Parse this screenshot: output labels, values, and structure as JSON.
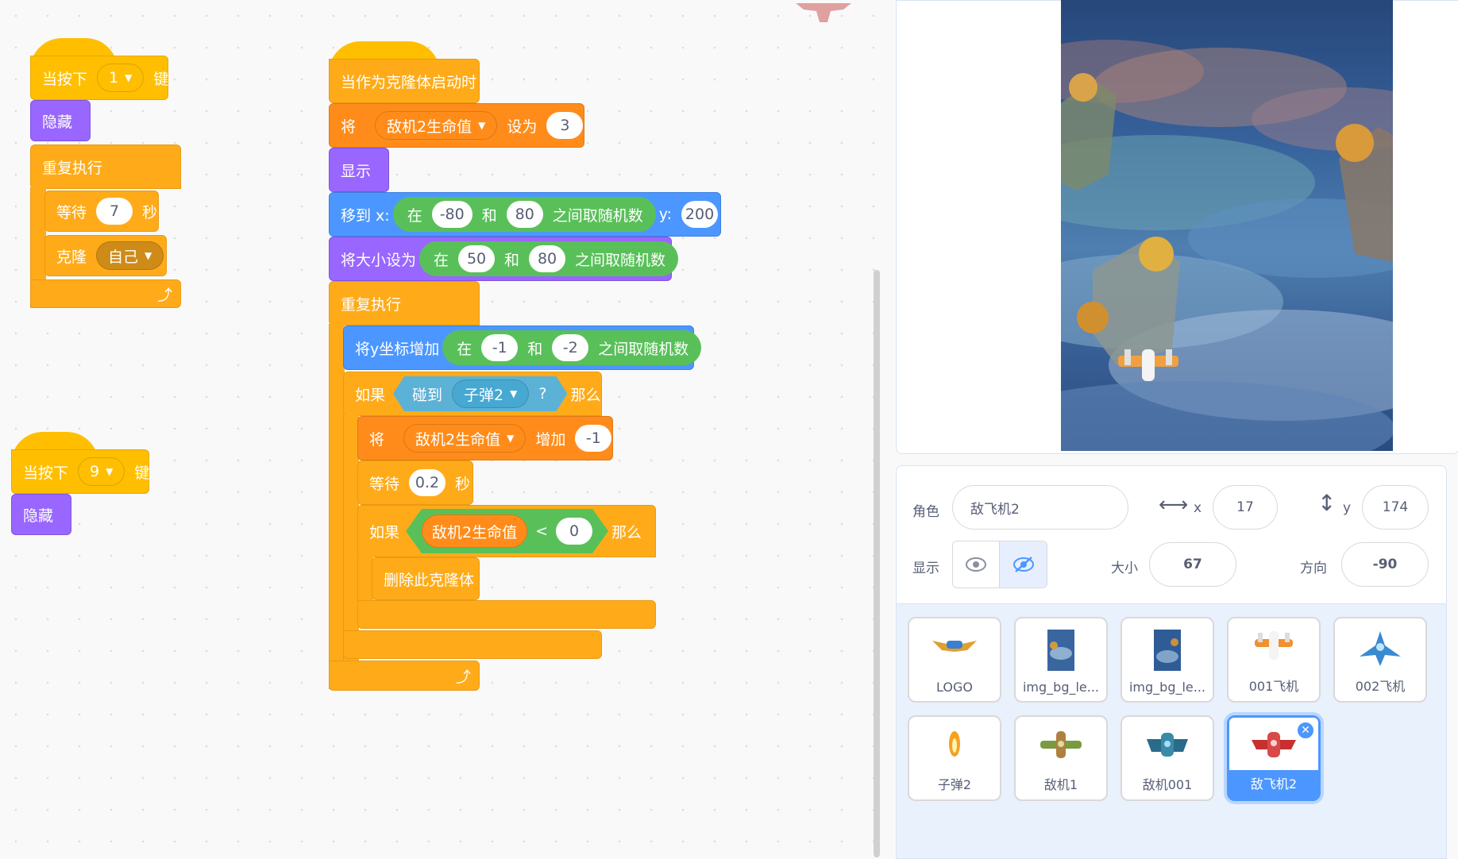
{
  "scripts": {
    "s1": {
      "hat": {
        "label_pre": "当按下",
        "key": "1",
        "label_post": "键"
      },
      "hide": "隐藏",
      "forever": "重复执行",
      "wait": {
        "label": "等待",
        "value": "7",
        "unit": "秒"
      },
      "clone": {
        "label": "克隆",
        "target": "自己"
      }
    },
    "s2": {
      "hat": {
        "label_pre": "当按下",
        "key": "9",
        "label_post": "键"
      },
      "hide": "隐藏"
    },
    "s3": {
      "hat": "当作为克隆体启动时",
      "setvar": {
        "label": "将",
        "var": "敌机2生命值",
        "to": "设为",
        "value": "3"
      },
      "show": "显示",
      "goto": {
        "label": "移到 x:",
        "in": "在",
        "a": "-80",
        "and": "和",
        "b": "80",
        "rand": "之间取随机数",
        "ylabel": "y:",
        "y": "200"
      },
      "size": {
        "label": "将大小设为",
        "in": "在",
        "a": "50",
        "and": "和",
        "b": "80",
        "rand": "之间取随机数"
      },
      "forever": "重复执行",
      "changey": {
        "label": "将y坐标增加",
        "in": "在",
        "a": "-1",
        "and": "和",
        "b": "-2",
        "rand": "之间取随机数"
      },
      "if1": {
        "label": "如果",
        "touch": "碰到",
        "target": "子弹2",
        "q": "?",
        "then": "那么"
      },
      "changevar": {
        "label": "将",
        "var": "敌机2生命值",
        "by": "增加",
        "value": "-1"
      },
      "wait": {
        "label": "等待",
        "value": "0.2",
        "unit": "秒"
      },
      "if2": {
        "label": "如果",
        "var": "敌机2生命值",
        "op": "<",
        "value": "0",
        "then": "那么"
      },
      "delete": "删除此克隆体"
    }
  },
  "info": {
    "sprite_label": "角色",
    "sprite_name": "敌飞机2",
    "x_label": "x",
    "x": "17",
    "y_label": "y",
    "y": "174",
    "show_label": "显示",
    "size_label": "大小",
    "size": "67",
    "dir_label": "方向",
    "dir": "-90"
  },
  "sprites": [
    {
      "name": "LOGO",
      "icon": "logo-wings-icon"
    },
    {
      "name": "img_bg_le...",
      "icon": "background-thumb-icon"
    },
    {
      "name": "img_bg_le...",
      "icon": "background-thumb-icon"
    },
    {
      "name": "001飞机",
      "icon": "plane-orange-icon"
    },
    {
      "name": "002飞机",
      "icon": "plane-blue-icon"
    },
    {
      "name": "子弹2",
      "icon": "bullet-flame-icon"
    },
    {
      "name": "敌机1",
      "icon": "enemy-green-plane-icon"
    },
    {
      "name": "敌机001",
      "icon": "enemy-teal-plane-icon"
    },
    {
      "name": "敌飞机2",
      "icon": "enemy-red-plane-icon",
      "selected": true
    }
  ],
  "colors": {
    "events": "#ffbf00",
    "control": "#ffab19",
    "looks": "#9966ff",
    "motion": "#4c97ff",
    "variables": "#ff8c1a",
    "operators": "#59c059",
    "sensing": "#5cb1d6"
  }
}
